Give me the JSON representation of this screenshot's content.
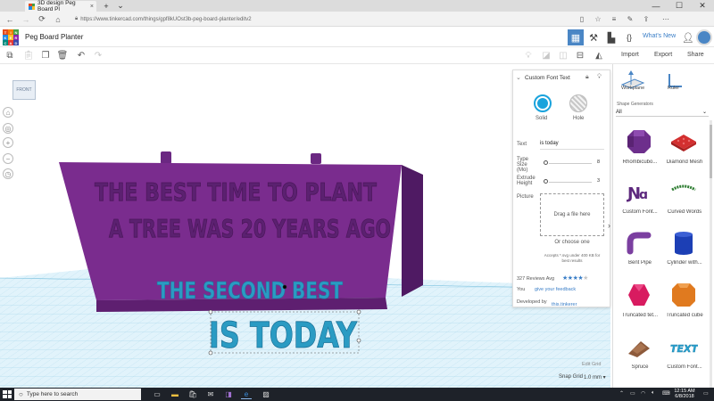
{
  "browser": {
    "tab_title": "3D design Peg Board Pl",
    "tab_close": "×",
    "new_tab": "+",
    "tab_dropdown": "⌄",
    "url": "https://www.tinkercad.com/things/gpf8kUOst3b-peg-board-planter/editv2",
    "window_controls": [
      "—",
      "☐",
      "✕"
    ]
  },
  "app": {
    "logo_letters": [
      "T",
      "I",
      "N",
      "K",
      "E",
      "R",
      "C",
      "A",
      "D"
    ],
    "logo_colors": [
      "#e64a19",
      "#f57c00",
      "#43a047",
      "#1e88e5",
      "#fbc02d",
      "#8e24aa",
      "#00897b",
      "#e53935",
      "#3949ab"
    ],
    "design_title": "Peg Board Planter",
    "whats_new": "What's New"
  },
  "toolbar": {
    "import": "Import",
    "export": "Export",
    "share": "Share"
  },
  "viewcube": {
    "face": "FRONT"
  },
  "model": {
    "line1": "THE BEST TIME TO PLANT",
    "line2": "A TREE WAS 20 YEARS AGO",
    "line3": "THE SECOND BEST",
    "line4": "IS TODAY",
    "board_color": "#7a2c8e",
    "text_color": "#2a9bc3"
  },
  "inspector": {
    "title": "Custom Font Text",
    "solid": "Solid",
    "hole": "Hole",
    "text_label": "Text",
    "text_value": "is today",
    "type_size_label": "Type Size (Mo)",
    "type_size_value": "8",
    "extrude_label": "Extrude Height",
    "extrude_value": "3",
    "picture_label": "Picture",
    "drag_file": "Drag a file here",
    "or_choose": "Or choose one",
    "accepts": "Accepts *.svg under 400 KB for best results",
    "reviews": "327 Reviews Avg",
    "rating": 4,
    "you_label": "You",
    "give_feedback": "give your feedback",
    "developed_by": "Developed by",
    "developer": "this.tinkerer"
  },
  "grid_controls": {
    "edit_grid": "Edit Grid",
    "snap_grid": "Snap Grid",
    "snap_value": "1.0 mm ▾"
  },
  "right_panel": {
    "workplane": "Workplane",
    "ruler": "Ruler",
    "shape_generators": "Shape Generators",
    "filter": "All",
    "shapes": [
      {
        "label": "Rhombicubo...",
        "color": "#6d2f8c"
      },
      {
        "label": "Diamond Mesh",
        "color": "#d32f2f"
      },
      {
        "label": "Custom Font...",
        "color": "#5e2a7e"
      },
      {
        "label": "Curved Words",
        "color": "#2e7d32"
      },
      {
        "label": "Bent Pipe",
        "color": "#7b3fa0"
      },
      {
        "label": "Cylinder with...",
        "color": "#1c3fb5"
      },
      {
        "label": "Truncated tet...",
        "color": "#d81b60"
      },
      {
        "label": "Truncated cube",
        "color": "#e07a1f"
      },
      {
        "label": "Spruce",
        "color": "#8d5a3b"
      },
      {
        "label": "Custom Font...",
        "color": "#29a3d1"
      }
    ]
  },
  "taskbar": {
    "search": "Type here to search",
    "time": "12:15 AM",
    "date": "6/8/2018"
  }
}
